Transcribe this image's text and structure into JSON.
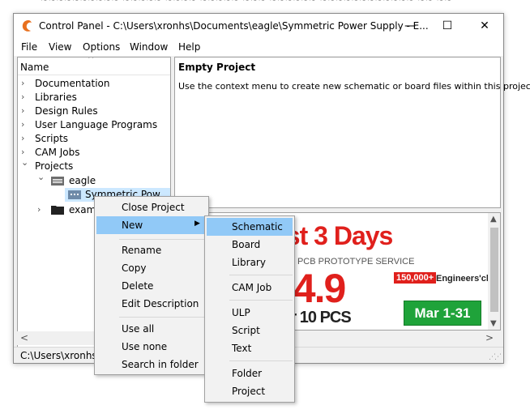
{
  "window": {
    "title": "Control Panel - C:\\Users\\xronhs\\Documents\\eagle\\Symmetric Power Supply - E...",
    "minimize_symbol": "—",
    "maximize_symbol": "☐",
    "close_symbol": "✕"
  },
  "menubar": [
    "File",
    "View",
    "Options",
    "Window",
    "Help"
  ],
  "tree": {
    "column_header": "Name",
    "items": [
      {
        "label": "Documentation",
        "expander": "›"
      },
      {
        "label": "Libraries",
        "expander": "›"
      },
      {
        "label": "Design Rules",
        "expander": "›"
      },
      {
        "label": "User Language Programs",
        "expander": "›"
      },
      {
        "label": "Scripts",
        "expander": "›"
      },
      {
        "label": "CAM Jobs",
        "expander": "›"
      },
      {
        "label": "Projects",
        "expander": "⌄"
      },
      {
        "label": "eagle",
        "expander": "⌄"
      },
      {
        "label": "Symmetric Pow",
        "expander": ""
      },
      {
        "label": "examp",
        "expander": "›"
      }
    ]
  },
  "info": {
    "title": "Empty Project",
    "description": "Use the context menu to create new schematic or board files within this project."
  },
  "ad": {
    "days": "ast 3 Days",
    "service": "TEST PCB PROTOTYPE SERVICE",
    "price": "$4.9",
    "qty": "For 10 PCS",
    "badge": "150,000+",
    "engineers": "Engineers'choi",
    "dates": "Mar 1-31"
  },
  "status": {
    "path": "C:\\Users\\xronhs\\"
  },
  "context_menu": {
    "items": [
      "Close Project",
      "New",
      "Rename",
      "Copy",
      "Delete",
      "Edit Description",
      "Use all",
      "Use none",
      "Search in folder"
    ],
    "submenu_arrow": "▶"
  },
  "new_submenu": {
    "items": [
      "Schematic",
      "Board",
      "Library",
      "CAM Job",
      "ULP",
      "Script",
      "Text",
      "Folder",
      "Project"
    ]
  },
  "colors": {
    "selection": "#cce8ff",
    "menu_highlight": "#91c9f7",
    "ad_red": "#e0201c",
    "ad_green": "#1fa33a"
  }
}
